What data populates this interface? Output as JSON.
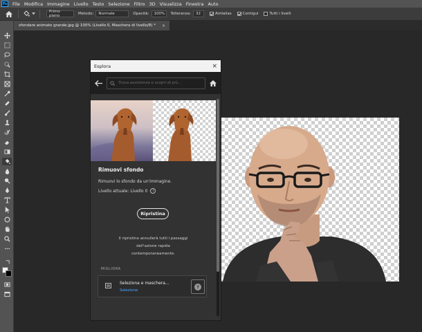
{
  "app": {
    "logo": "Ps"
  },
  "menubar": {
    "items": [
      "File",
      "Modifica",
      "Immagine",
      "Livello",
      "Testo",
      "Selezione",
      "Filtro",
      "3D",
      "Visualizza",
      "Finestra",
      "Auto"
    ]
  },
  "options": {
    "brush_mode": "Primo piano",
    "metodo_label": "Metodo:",
    "metodo_value": "Normale",
    "opacita_label": "Opacità:",
    "opacita_value": "100%",
    "tolleranza_label": "Tolleranza:",
    "tolleranza_value": "32",
    "anti_alias": "Antialias",
    "contigui": "Contigui",
    "tutti_livelli": "Tutti i livelli"
  },
  "document": {
    "tab_title": "sfondare animato grande.jpg @ 100% (Livello 0, Maschera di livello/8) *",
    "tab_close": "×"
  },
  "explore": {
    "title": "Esplora",
    "close": "×",
    "search_placeholder": "Trova assistenza e scopri di più...",
    "feature_title": "Rimuovi sfondo",
    "feature_desc": "Rimuovi lo sfondo da un'immagine.",
    "feature_level": "Livello attuale: Livello 0",
    "info": "i",
    "restore_button": "Ripristina",
    "restore_note": [
      "Il ripristino annullerà tutti i passaggi",
      "dell'azione rapida",
      "contemporaneamente."
    ],
    "improve_header": "MIGLIORA",
    "card_title": "Seleziona e maschera...",
    "card_subtitle": "Selezione",
    "card_help": "?"
  },
  "colors": {
    "accent": "#31a8ff",
    "link_blue": "#4aa7ff",
    "panel_bg": "#323232",
    "canvas_bg": "#282828",
    "foreground_swatch": "#f2f2f2",
    "background_swatch": "#000000"
  },
  "icons": [
    "home-icon",
    "paint-bucket-icon",
    "back-arrow-icon",
    "search-icon",
    "home-icon",
    "info-icon",
    "mask-icon",
    "help-icon"
  ]
}
